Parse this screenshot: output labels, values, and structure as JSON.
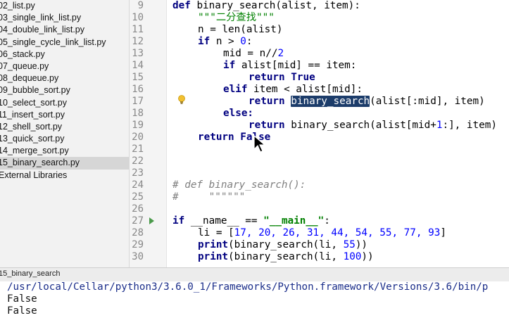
{
  "project_tree": {
    "files": [
      "02_list.py",
      "03_single_link_list.py",
      "04_double_link_list.py",
      "05_single_cycle_link_list.py",
      "06_stack.py",
      "07_queue.py",
      "08_dequeue.py",
      "09_bubble_sort.py",
      "10_select_sort.py",
      "11_insert_sort.py",
      "12_shell_sort.py",
      "13_quick_sort.py",
      "14_merge_sort.py",
      "15_binary_search.py"
    ],
    "selected": "15_binary_search.py",
    "external_libraries": "External Libraries"
  },
  "editor": {
    "line_numbers": [
      "9",
      "10",
      "11",
      "12",
      "13",
      "14",
      "15",
      "16",
      "17",
      "18",
      "19",
      "20",
      "21",
      "22",
      "23",
      "24",
      "25",
      "26",
      "27",
      "28",
      "29",
      "30"
    ],
    "code": {
      "l9_kw": "def ",
      "l9_rest": "binary_search(alist, item):",
      "l10_doc": "\"\"\"二分查找\"\"\"",
      "l11": "n = len(alist)",
      "l12_kw": "if ",
      "l12_rest": "n > ",
      "l12_num": "0",
      "l12_end": ":",
      "l13_a": "mid = n//",
      "l13_num": "2",
      "l14_kw": "if ",
      "l14_rest": "alist[mid] == item:",
      "l15_kw": "return True",
      "l16_kw": "elif ",
      "l16_rest": "item < alist[mid]:",
      "l17_kw": "return ",
      "l17_hl": "binary_search",
      "l17_rest": "(alist[:mid], item)",
      "l18_kw": "else:",
      "l19_kw": "return ",
      "l19_rest": "binary_search(alist[mid+",
      "l19_num": "1",
      "l19_end": ":], item)",
      "l20_kw": "return False",
      "l24_cm": "# def binary_search():",
      "l25_cm": "#     \"\"\"\"\"\"",
      "l27_kw": "if ",
      "l27_rest": "__name__ == ",
      "l27_str": "\"__main__\"",
      "l27_end": ":",
      "l28_a": "li = [",
      "l28_nums": "17, 20, 26, 31, 44, 54, 55, 77, 93",
      "l28_end": "]",
      "l29_kw": "print",
      "l29_rest": "(binary_search(li, ",
      "l29_num": "55",
      "l29_end": "))",
      "l30_kw": "print",
      "l30_rest": "(binary_search(li, ",
      "l30_num": "100",
      "l30_end": "))"
    }
  },
  "run_panel": {
    "label": "15_binary_search",
    "output": [
      "/usr/local/Cellar/python3/3.6.0_1/Frameworks/Python.framework/Versions/3.6/bin/p",
      "False",
      "False"
    ]
  },
  "colors": {
    "keyword": "#000080",
    "string": "#008000",
    "number": "#0000ff",
    "comment": "#808080",
    "highlight": "#1c3c6a"
  }
}
